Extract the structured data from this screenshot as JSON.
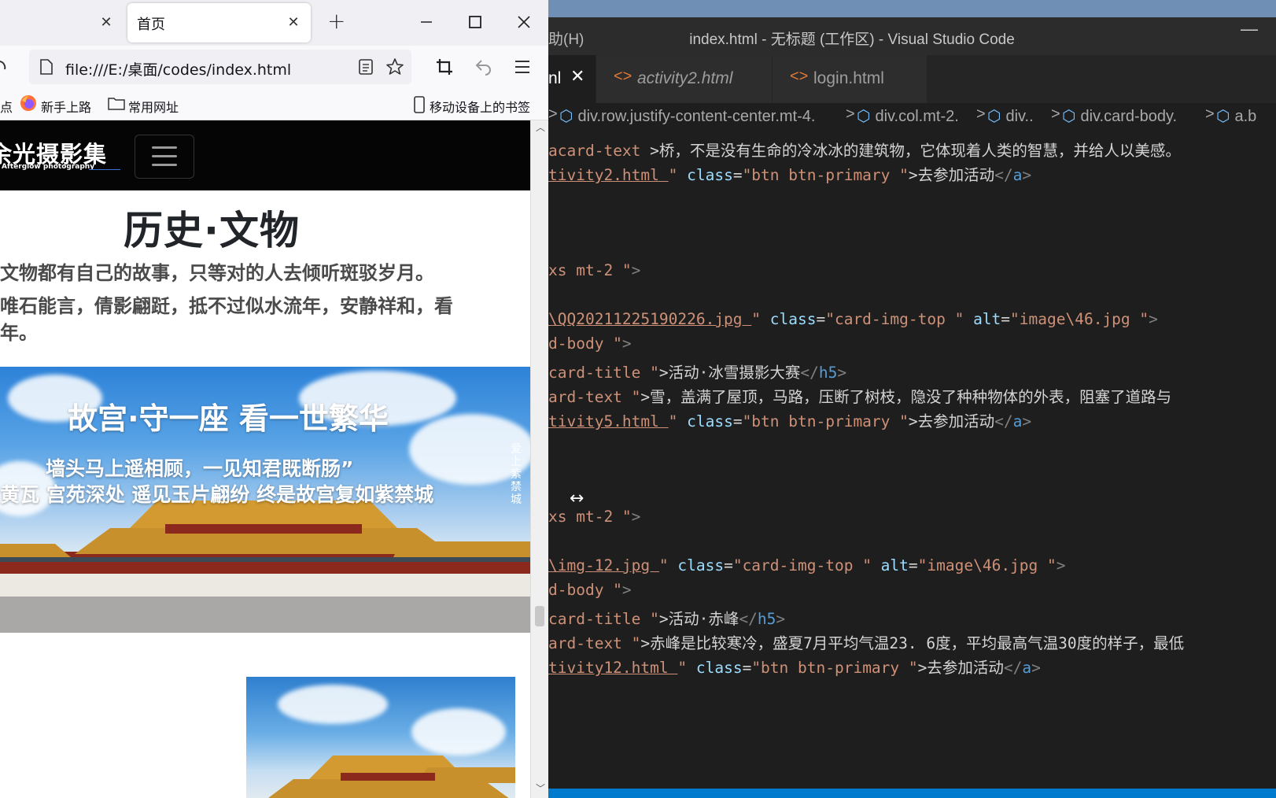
{
  "browser": {
    "tabs": [
      {
        "label": "",
        "active": false
      },
      {
        "label": "首页",
        "active": true
      }
    ],
    "url": "file:///E:/桌面/codes/index.html",
    "bookmarks": [
      {
        "label": "点",
        "icon": "firefox-icon"
      },
      {
        "label": "新手上路",
        "icon": "firefox-icon"
      },
      {
        "label": "常用网址",
        "icon": "folder-icon"
      },
      {
        "label": "移动设备上的书签",
        "icon": "mobile-icon"
      }
    ],
    "page": {
      "logo_cn": "余光摄影集",
      "logo_en": "Afterglow photography",
      "heading": "历史·文物",
      "lead_lines": [
        "文物都有自己的故事，只等对的人去倾听斑驳岁月。",
        "唯石能言，倩影翩跹，抵不过似水流年，安静祥和，看",
        "年。"
      ],
      "banner": {
        "headline": "故宫·守一座 看一世繁华",
        "line1": "墙头马上遥相顾，一见知君既断肠”",
        "line2": "黄瓦 宫苑深处 遥见玉片翩纷 终是故宫复如紫禁城",
        "vertical": "爱上紫禁城"
      }
    }
  },
  "vscode": {
    "menu_fragment": "助(H)",
    "title": "index.html - 无标题 (工作区) - Visual Studio Code",
    "tabs": [
      {
        "label": "nl",
        "active": true
      },
      {
        "label": "activity2.html",
        "active": false,
        "italic": true
      },
      {
        "label": "login.html",
        "active": false
      }
    ],
    "breadcrumb": [
      "div.row.justify-content-center.mt-4.",
      "div.col.mt-2.",
      "div..",
      "div.card-body.",
      "a.b"
    ],
    "code_lines": [
      {
        "row": 0,
        "parts": [
          [
            "s",
            "card-text "
          ],
          [
            "w",
            ">桥，不是没有生命的冷冰冰的建筑物，它体现着人类的智慧，并给人以美感。"
          ]
        ],
        "prefix": "a"
      },
      {
        "row": 1,
        "parts": [
          [
            "su",
            "tivity2.html "
          ],
          [
            "s",
            "\" "
          ],
          [
            "a",
            "class"
          ],
          [
            "w",
            "="
          ],
          [
            "s",
            "\"btn btn-primary \""
          ],
          [
            "w",
            ">去参加活动"
          ],
          [
            "p",
            "</"
          ],
          [
            "t",
            "a"
          ],
          [
            "p",
            ">"
          ]
        ]
      },
      {
        "row": 5,
        "parts": [
          [
            "s",
            "xs mt-2 \""
          ],
          [
            "p",
            ">"
          ]
        ]
      },
      {
        "row": 7,
        "parts": [
          [
            "su",
            "\\QQ20211225190226.jpg "
          ],
          [
            "s",
            "\" "
          ],
          [
            "a",
            "class"
          ],
          [
            "w",
            "="
          ],
          [
            "s",
            "\"card-img-top \" "
          ],
          [
            "a",
            "alt"
          ],
          [
            "w",
            "="
          ],
          [
            "s",
            "\"image\\46.jpg \""
          ],
          [
            "p",
            ">"
          ]
        ]
      },
      {
        "row": 8,
        "parts": [
          [
            "s",
            "d-body \""
          ],
          [
            "p",
            ">"
          ]
        ]
      },
      {
        "row": 9,
        "parts": [
          [
            "s",
            "card-title \""
          ],
          [
            "w",
            ">活动·冰雪摄影大赛"
          ],
          [
            "p",
            "</"
          ],
          [
            "t",
            "h5"
          ],
          [
            "p",
            ">"
          ]
        ]
      },
      {
        "row": 10,
        "parts": [
          [
            "s",
            "ard-text \""
          ],
          [
            "w",
            ">雪，盖满了屋顶，马路，压断了树枝，隐没了种种物体的外表，阻塞了道路与"
          ]
        ]
      },
      {
        "row": 11,
        "parts": [
          [
            "su",
            "tivity5.html "
          ],
          [
            "s",
            "\" "
          ],
          [
            "a",
            "class"
          ],
          [
            "w",
            "="
          ],
          [
            "s",
            "\"btn btn-primary \""
          ],
          [
            "w",
            ">去参加活动"
          ],
          [
            "p",
            "</"
          ],
          [
            "t",
            "a"
          ],
          [
            "p",
            ">"
          ]
        ]
      },
      {
        "row": 15,
        "parts": [
          [
            "s",
            "xs mt-2 \""
          ],
          [
            "p",
            ">"
          ]
        ]
      },
      {
        "row": 17,
        "parts": [
          [
            "su",
            "\\img-12.jpg "
          ],
          [
            "s",
            "\" "
          ],
          [
            "a",
            "class"
          ],
          [
            "w",
            "="
          ],
          [
            "s",
            "\"card-img-top \" "
          ],
          [
            "a",
            "alt"
          ],
          [
            "w",
            "="
          ],
          [
            "s",
            "\"image\\46.jpg \""
          ],
          [
            "p",
            ">"
          ]
        ]
      },
      {
        "row": 18,
        "parts": [
          [
            "s",
            "d-body \""
          ],
          [
            "p",
            ">"
          ]
        ]
      },
      {
        "row": 19,
        "parts": [
          [
            "s",
            "card-title \""
          ],
          [
            "w",
            ">活动·赤峰"
          ],
          [
            "p",
            "</"
          ],
          [
            "t",
            "h5"
          ],
          [
            "p",
            ">"
          ]
        ]
      },
      {
        "row": 20,
        "parts": [
          [
            "s",
            "ard-text \""
          ],
          [
            "w",
            ">赤峰是比较寒冷，盛夏7月平均气温23. 6度，平均最高气温30度的样子，最低"
          ]
        ]
      },
      {
        "row": 21,
        "parts": [
          [
            "su",
            "tivity12.html "
          ],
          [
            "s",
            "\" "
          ],
          [
            "a",
            "class"
          ],
          [
            "w",
            "="
          ],
          [
            "s",
            "\"btn btn-primary \""
          ],
          [
            "w",
            ">去参加活动"
          ],
          [
            "p",
            "</"
          ],
          [
            "t",
            "a"
          ],
          [
            "p",
            ">"
          ]
        ]
      }
    ]
  }
}
